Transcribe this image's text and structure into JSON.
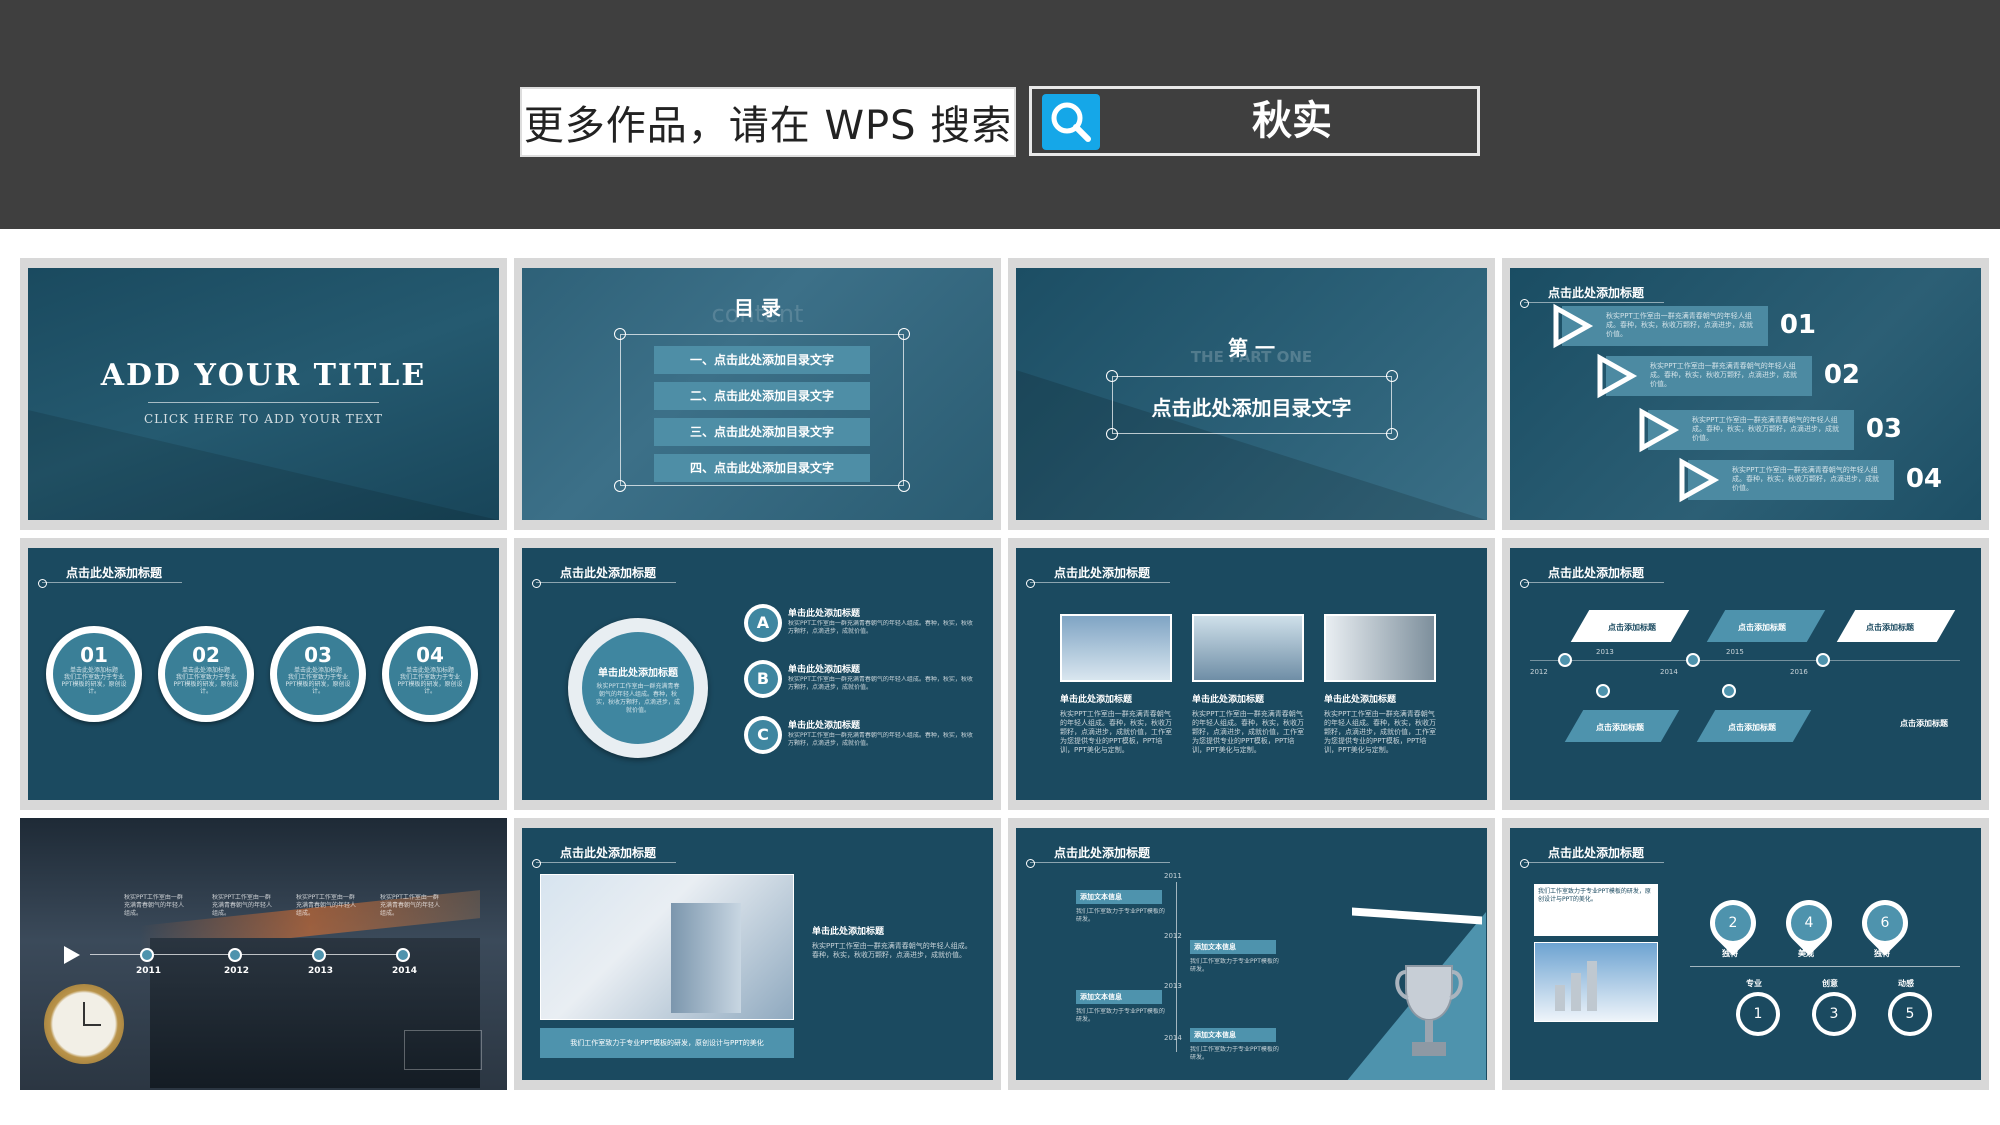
{
  "banner": {
    "promo_text": "更多作品，请在 WPS 搜索",
    "search_term": "秋实"
  },
  "slides": {
    "s1": {
      "title": "ADD YOUR TITLE",
      "subtitle": "CLICK HERE TO ADD YOUR TEXT"
    },
    "s2": {
      "title": "目 录",
      "watermark": "content",
      "items": [
        "一、点击此处添加目录文字",
        "二、点击此处添加目录文字",
        "三、点击此处添加目录文字",
        "四、点击此处添加目录文字"
      ]
    },
    "s3": {
      "part": "第 一",
      "part_en": "THE PART ONE",
      "title": "点击此处添加目录文字"
    },
    "s4": {
      "title": "点击此处添加标题",
      "nums": [
        "01",
        "02",
        "03",
        "04"
      ],
      "text": "秋实PPT工作室由一群充满青春朝气的年轻人组成。春种，秋实，秋收万颗籽，点滴进步，成就价值。"
    },
    "s5": {
      "title": "点击此处添加标题",
      "nums": [
        "01",
        "02",
        "03",
        "04"
      ],
      "label": "单击此处添加标题",
      "text": "我们工作室致力于专业PPT模板的研发，原创设计。"
    },
    "s6": {
      "title": "点击此处添加标题",
      "center": "单击此处添加标题",
      "letters": [
        "A",
        "B",
        "C"
      ],
      "item_title": "单击此处添加标题",
      "text": "秋实PPT工作室由一群充满青春朝气的年轻人组成。春种，秋实，秋收万颗籽，点滴进步，成就价值。"
    },
    "s7": {
      "title": "点击此处添加标题",
      "cols": [
        "单击此处添加标题",
        "单击此处添加标题",
        "单击此处添加标题"
      ],
      "text": "秋实PPT工作室由一群充满青春朝气的年轻人组成。春种，秋实，秋收万颗籽，点滴进步，成就价值，工作室为您提供专业的PPT模板，PPT培训，PPT美化与定制。"
    },
    "s8": {
      "title": "点击此处添加标题",
      "years": [
        "2012",
        "2013",
        "2014",
        "2015",
        "2016"
      ],
      "box_title": "点击添加标题",
      "side": "点击添加标题"
    },
    "s9": {
      "years": [
        "2011",
        "2012",
        "2013",
        "2014"
      ],
      "text": "秋实PPT工作室由一群充满青春朝气的年轻人组成。"
    },
    "s10": {
      "title": "点击此处添加标题",
      "sub": "单击此处添加标题",
      "text": "秋实PPT工作室由一群充满青春朝气的年轻人组成。春种，秋实，秋收万颗籽，点滴进步，成就价值。",
      "footer": "我们工作室致力于专业PPT模板的研发，原创设计与PPT的美化"
    },
    "s11": {
      "title": "点击此处添加标题",
      "years": [
        "2011",
        "2012",
        "2013",
        "2014"
      ],
      "label": "添加文本信息",
      "text": "我们工作室致力于专业PPT模板的研发。"
    },
    "s12": {
      "title": "点击此处添加标题",
      "pins": [
        "2",
        "4",
        "6"
      ],
      "pin_labels": [
        "独特",
        "美观",
        "独特"
      ],
      "nums": [
        "1",
        "3",
        "5"
      ],
      "num_labels": [
        "专业",
        "创意",
        "动感"
      ],
      "text": "我们工作室致力于专业PPT模板的研发，原创设计与PPT的美化。"
    }
  }
}
